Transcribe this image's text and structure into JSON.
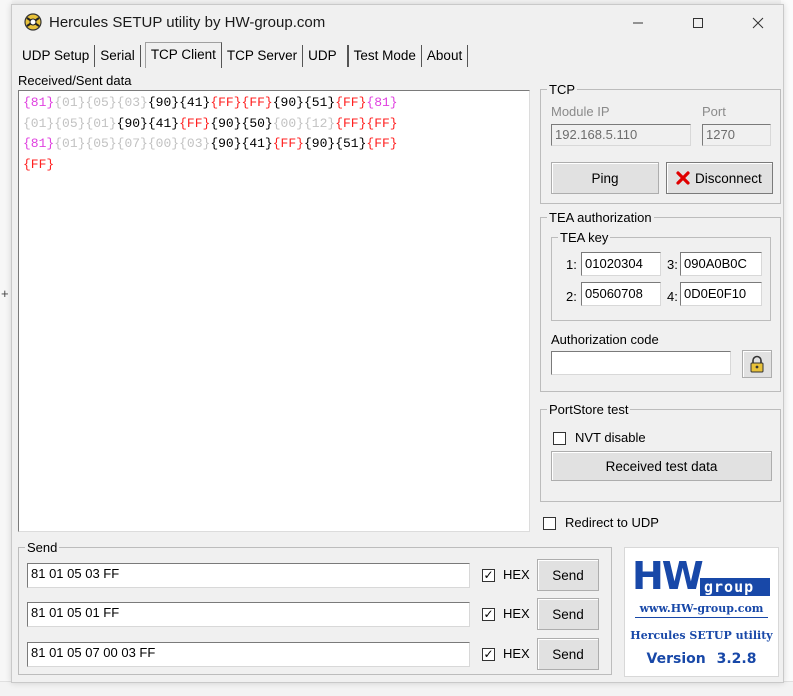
{
  "window": {
    "title": "Hercules SETUP utility by HW-group.com"
  },
  "tabs": [
    {
      "label": "UDP Setup"
    },
    {
      "label": "Serial"
    },
    {
      "label": "TCP Client"
    },
    {
      "label": "TCP Server"
    },
    {
      "label": "UDP"
    },
    {
      "label": "Test Mode"
    },
    {
      "label": "About"
    }
  ],
  "received": {
    "label": "Received/Sent data",
    "lines": [
      [
        {
          "t": "{81}",
          "c": "pink"
        },
        {
          "t": "{01}",
          "c": "gray"
        },
        {
          "t": "{05}",
          "c": "gray"
        },
        {
          "t": "{03}",
          "c": "gray"
        },
        {
          "t": "{90}",
          "c": "black"
        },
        {
          "t": "{41}",
          "c": "black"
        },
        {
          "t": "{FF}",
          "c": "red"
        },
        {
          "t": "{FF}",
          "c": "red"
        },
        {
          "t": "{90}",
          "c": "black"
        },
        {
          "t": "{51}",
          "c": "black"
        },
        {
          "t": "{FF}",
          "c": "red"
        },
        {
          "t": "{81}",
          "c": "pink"
        }
      ],
      [
        {
          "t": "{01}",
          "c": "gray"
        },
        {
          "t": "{05}",
          "c": "gray"
        },
        {
          "t": "{01}",
          "c": "gray"
        },
        {
          "t": "{90}",
          "c": "black"
        },
        {
          "t": "{41}",
          "c": "black"
        },
        {
          "t": "{FF}",
          "c": "red"
        },
        {
          "t": "{90}",
          "c": "black"
        },
        {
          "t": "{50}",
          "c": "black"
        },
        {
          "t": "{00}",
          "c": "gray"
        },
        {
          "t": "{12}",
          "c": "gray"
        },
        {
          "t": "{FF}",
          "c": "red"
        },
        {
          "t": "{FF}",
          "c": "red"
        }
      ],
      [
        {
          "t": "{81}",
          "c": "pink"
        },
        {
          "t": "{01}",
          "c": "gray"
        },
        {
          "t": "{05}",
          "c": "gray"
        },
        {
          "t": "{07}",
          "c": "gray"
        },
        {
          "t": "{00}",
          "c": "gray"
        },
        {
          "t": "{03}",
          "c": "gray"
        },
        {
          "t": "{90}",
          "c": "black"
        },
        {
          "t": "{41}",
          "c": "black"
        },
        {
          "t": "{FF}",
          "c": "red"
        },
        {
          "t": "{90}",
          "c": "black"
        },
        {
          "t": "{51}",
          "c": "black"
        },
        {
          "t": "{FF}",
          "c": "red"
        }
      ],
      [
        {
          "t": "{FF}",
          "c": "red"
        }
      ]
    ]
  },
  "tcp": {
    "legend": "TCP",
    "module_ip_label": "Module IP",
    "module_ip": "192.168.5.110",
    "port_label": "Port",
    "port": "1270",
    "ping_label": "Ping",
    "disconnect_label": "Disconnect"
  },
  "tea": {
    "legend": "TEA authorization",
    "key_legend": "TEA key",
    "key1_label": "1:",
    "key1": "01020304",
    "key2_label": "2:",
    "key2": "05060708",
    "key3_label": "3:",
    "key3": "090A0B0C",
    "key4_label": "4:",
    "key4": "0D0E0F10",
    "auth_code_label": "Authorization code",
    "auth_code": ""
  },
  "portstore": {
    "legend": "PortStore test",
    "nvt_label": "NVT disable",
    "nvt_checked": false,
    "received_test_label": "Received test data"
  },
  "redirect": {
    "label": "Redirect to UDP",
    "checked": false
  },
  "send": {
    "legend": "Send",
    "rows": [
      {
        "value": "81 01 05 03 FF",
        "hex_label": "HEX",
        "hex_checked": true,
        "button": "Send"
      },
      {
        "value": "81 01 05 01 FF",
        "hex_label": "HEX",
        "hex_checked": true,
        "button": "Send"
      },
      {
        "value": "81 01 05 07 00 03 FF",
        "hex_label": "HEX",
        "hex_checked": true,
        "button": "Send"
      }
    ]
  },
  "logo": {
    "brand": "HW",
    "group": "group",
    "url": "www.HW-group.com",
    "product": "Hercules SETUP utility",
    "version_label": "Version",
    "version": "3.2.8"
  },
  "colors": {
    "pink": "#e040e0",
    "gray": "#c2c2c2",
    "red": "#ff2020",
    "logo_blue": "#1848a8"
  }
}
